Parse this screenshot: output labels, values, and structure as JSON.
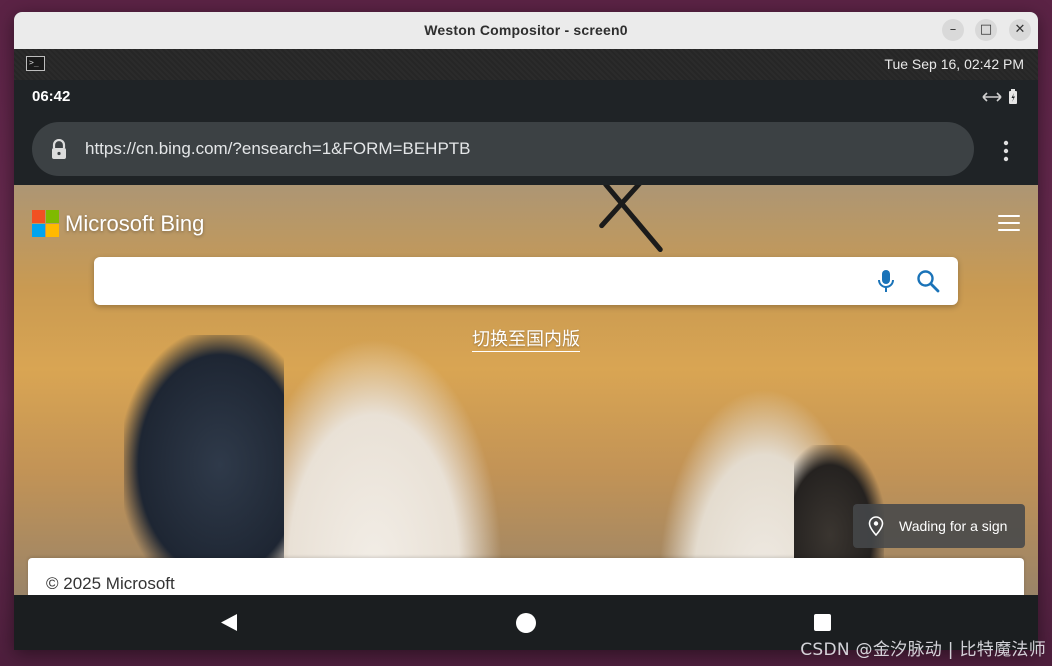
{
  "window": {
    "title": "Weston Compositor - screen0",
    "minimize_glyph": "–",
    "maximize_glyph": "□",
    "close_glyph": "✕"
  },
  "weston_panel": {
    "terminal_glyph": ">_",
    "clock": "Tue Sep 16, 02:42 PM"
  },
  "android_status": {
    "time": "06:42",
    "icons": [
      "data-transfer-icon",
      "battery-icon"
    ]
  },
  "browser": {
    "url": "https://cn.bing.com/?ensearch=1&FORM=BEHPTB",
    "secure": true
  },
  "bing": {
    "logo_text": "Microsoft Bing",
    "logo_colors": [
      "#f25022",
      "#7fba00",
      "#00a4ef",
      "#ffb900"
    ],
    "search_value": "",
    "switch_link": "切换至国内版",
    "image_caption": "Wading for a sign",
    "copyright": "© 2025 Microsoft",
    "accent": "#1a73b8"
  },
  "watermark": "CSDN @金汐脉动 | 比特魔法师"
}
